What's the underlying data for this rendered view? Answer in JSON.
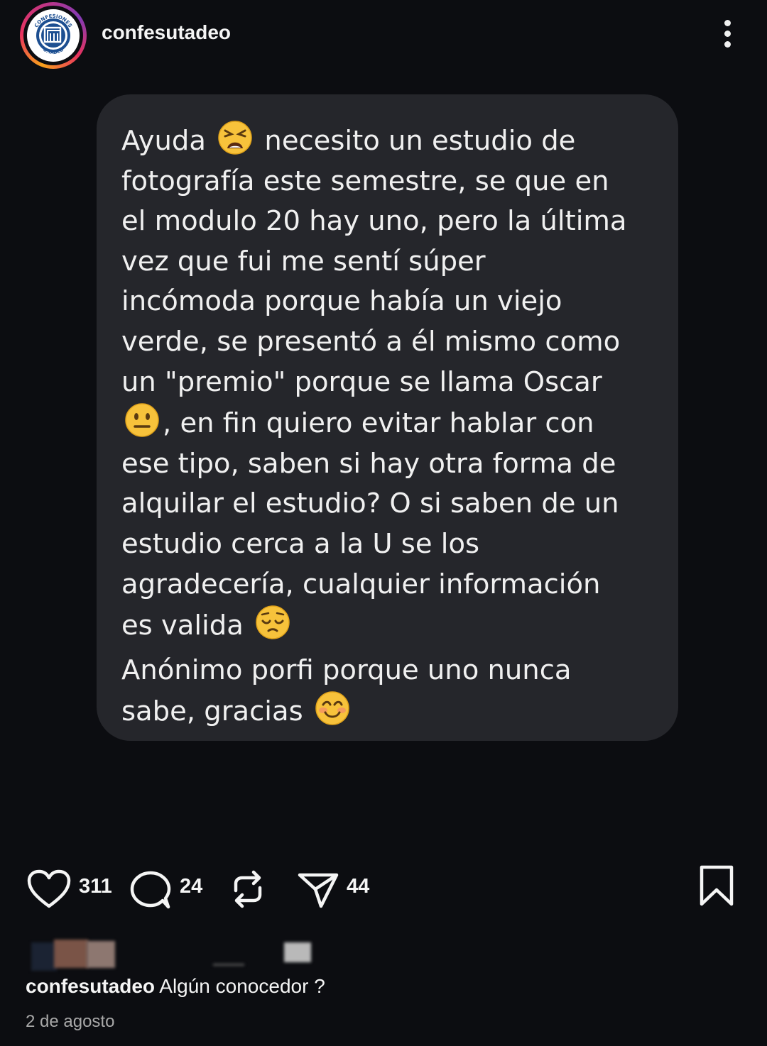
{
  "header": {
    "username": "confesutadeo",
    "avatar_text_top": "CONFESIONES",
    "avatar_text_bottom": "U.TADEO"
  },
  "post": {
    "message_lines": [
      [
        "Ayuda ",
        "tired-face-emoji",
        " necesito un estudio de"
      ],
      [
        "fotografía este semestre, se que en"
      ],
      [
        "el modulo 20 hay uno, pero la última"
      ],
      [
        "vez que fui me sentí súper"
      ],
      [
        "incómoda porque había un viejo"
      ],
      [
        "verde, se presentó a él mismo como"
      ],
      [
        "un \"premio\" porque se llama Oscar"
      ],
      [
        "neutral-face-emoji",
        ", en fin quiero evitar hablar con"
      ],
      [
        "ese tipo, saben si hay otra forma de"
      ],
      [
        "alquilar el estudio? O si saben de un"
      ],
      [
        "estudio cerca a la U se los"
      ],
      [
        "agradecería, cualquier información"
      ],
      [
        "es valida ",
        "pensive-face-emoji"
      ],
      [
        "Anónimo porfi porque uno nunca"
      ],
      [
        "sabe, gracias ",
        "smiling-face-emoji"
      ]
    ]
  },
  "actions": {
    "likes": "311",
    "comments": "24",
    "shares": "44"
  },
  "caption": {
    "username": "confesutadeo",
    "text": " Algún conocedor ?",
    "date": "2 de agosto"
  },
  "colors": {
    "background": "#0c0d11",
    "bubble": "#25262b",
    "text": "#f0f0f0",
    "muted": "#a8a8a8"
  }
}
